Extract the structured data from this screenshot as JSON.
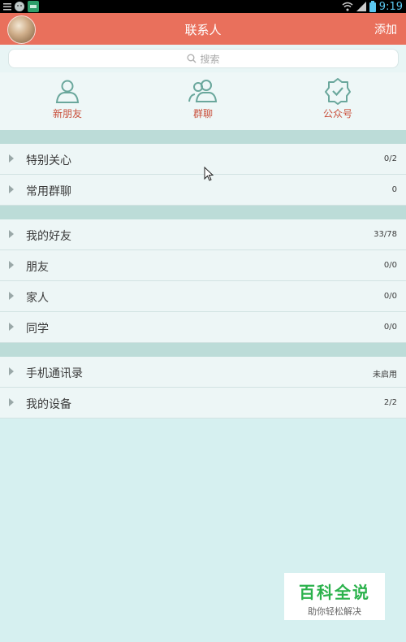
{
  "status_bar": {
    "time": "9:19",
    "icons": [
      "menu-icon",
      "cat-icon",
      "app-icon",
      "wifi-icon",
      "signal-icon",
      "battery-icon"
    ]
  },
  "header": {
    "title": "联系人",
    "add_label": "添加"
  },
  "search": {
    "placeholder": "搜索"
  },
  "quick_actions": [
    {
      "label": "新朋友",
      "icon": "person-icon"
    },
    {
      "label": "群聊",
      "icon": "group-icon"
    },
    {
      "label": "公众号",
      "icon": "badge-check-icon"
    }
  ],
  "groups": {
    "special": [
      {
        "label": "特别关心",
        "count": "0/2"
      },
      {
        "label": "常用群聊",
        "count": "0"
      }
    ],
    "friends": [
      {
        "label": "我的好友",
        "count": "33/78"
      },
      {
        "label": "朋友",
        "count": "0/0"
      },
      {
        "label": "家人",
        "count": "0/0"
      },
      {
        "label": "同学",
        "count": "0/0"
      }
    ],
    "devices": [
      {
        "label": "手机通讯录",
        "count": "未启用"
      },
      {
        "label": "我的设备",
        "count": "2/2"
      }
    ]
  },
  "watermark": {
    "title": "百科全说",
    "subtitle": "助你轻松解决"
  },
  "colors": {
    "accent": "#e9705c",
    "background": "#d6f0f0",
    "quick_label": "#c9503c",
    "icon_stroke": "#6aa79c"
  }
}
